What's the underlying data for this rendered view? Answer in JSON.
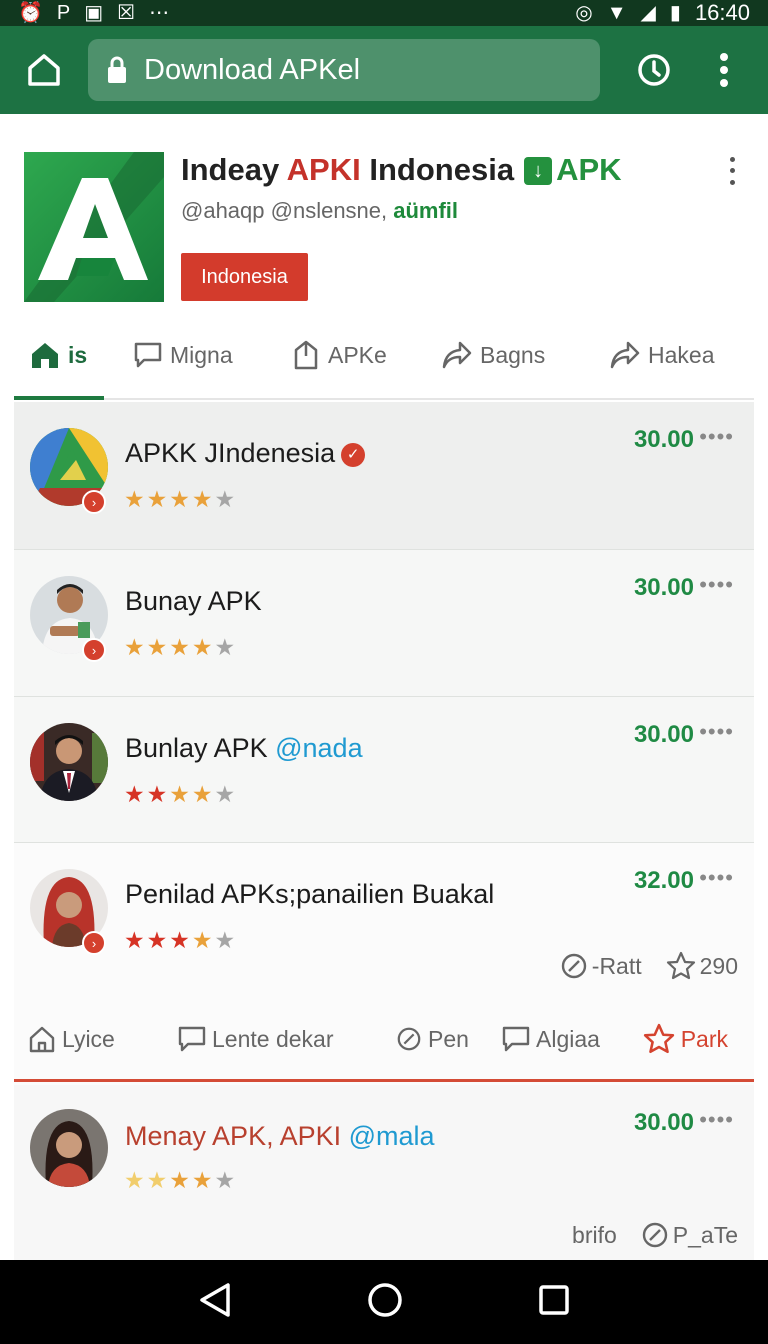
{
  "status_bar": {
    "left_icons": [
      "alarm-icon",
      "p-icon",
      "image-icon",
      "close-icon",
      "dots-icon"
    ],
    "p_label": "P",
    "time": "16:40"
  },
  "browser": {
    "url_text": "Download APKel"
  },
  "app": {
    "title_part1": "Indeay ",
    "title_part2": "APKI",
    "title_part3": " Indonesia",
    "title_apk": "APK",
    "subtitle_plain": "@ahaqp @nslensne, ",
    "subtitle_bold": "aümfil",
    "country_button": "Indonesia"
  },
  "tabs": [
    {
      "label": "is",
      "icon": "home-icon",
      "active": true
    },
    {
      "label": "Migna",
      "icon": "comment-icon",
      "active": false
    },
    {
      "label": "APKe",
      "icon": "tag-icon",
      "active": false
    },
    {
      "label": "Bagns",
      "icon": "share-icon",
      "active": false
    },
    {
      "label": "Hakea",
      "icon": "share-icon",
      "active": false
    }
  ],
  "rows": [
    {
      "title": "APKK JIndenesia",
      "handle": "",
      "price": "30.00",
      "rating": 4,
      "verified": true
    },
    {
      "title": "Bunay APK",
      "handle": "",
      "price": "30.00",
      "rating": 4,
      "verified": false
    },
    {
      "title": "Bunlay APK ",
      "handle": "@nada",
      "price": "30.00",
      "rating": 3.5,
      "verified": false
    },
    {
      "title": "Penilad APKs;panailien Buakal",
      "handle": "",
      "price": "32.00",
      "rating": 3.5,
      "verified": false
    },
    {
      "title": "Menay APK, APKI ",
      "handle": "@mala",
      "price": "30.00",
      "rating": 4,
      "verified": false
    }
  ],
  "row4_meta": {
    "rate_label": "-Ratt",
    "star_count": "290"
  },
  "row4_actions": {
    "a1": "Lyice",
    "a2": "Lente dekar",
    "a3": "Pen",
    "a4": "Algiaa",
    "a5": "Park"
  },
  "row5_meta": {
    "info": "brifo",
    "p_label": "P_aTe"
  },
  "more_label": "••••",
  "colors": {
    "brand_green": "#1d7243",
    "status_dark": "#11381f",
    "accent_red": "#d33b2c",
    "price_green": "#1f8a44",
    "handle_blue": "#1f9ad1"
  }
}
